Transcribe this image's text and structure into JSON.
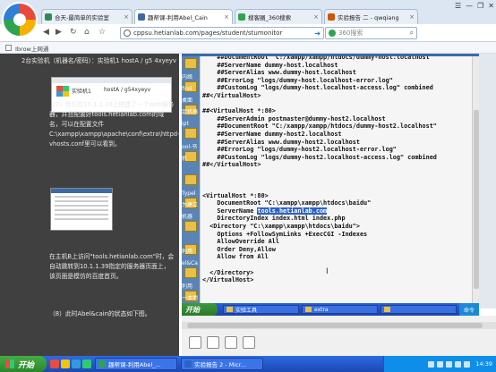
{
  "browser": {
    "tabs": [
      {
        "label": "合天-最简单的实验室",
        "icon_color": "#2e8b57",
        "active": false
      },
      {
        "label": "趣帮课-利用Abel_Cain",
        "icon_color": "#3b6aa5",
        "active": true
      },
      {
        "label": "搜客圈_360搜索",
        "icon_color": "#2ea44f",
        "active": false
      },
      {
        "label": "实验报告 二 - qwqiang",
        "icon_color": "#d35400",
        "active": false
      }
    ],
    "window_controls": [
      "☰",
      "—",
      "❐",
      "✕"
    ],
    "url": "cppsu.hetianlab.com/pages/student/stumonitor",
    "search_placeholder": "360搜索",
    "favorites": [
      {
        "label": "Ibrow上网通"
      }
    ]
  },
  "article": {
    "top_info": "2台实验机（机器名/密码）：实验机1 hostA / g5 4xyeyv",
    "thumb1": {
      "label": "实验机1",
      "path": "hostA / g54xyeyv"
    },
    "paragraphs": [
      "（7）我们在10.1.1.39上搭建了一个web服务器，并且配置好tools.hetianlab.com的域名，可以在配置文件C:\\xampp\\xampp\\apache\\conf\\extra\\httpd-vhosts.conf里可以看到。",
      "在主机B上访问\"tools.hetianlab.com\"时，会自动跳转到10.1.1.39指定的服务器页面上，该页面是模仿的百度首页。",
      "（8）此时Abel&cain的状态如下图。"
    ]
  },
  "editor": {
    "lines": [
      "    ##DocumentRoot \"C:/xampp/xampp/htdocs/dummy-host.localhost\"",
      "    ##ServerName dummy-host.localhost",
      "    ##ServerAlias www.dummy-host.localhost",
      "    ##ErrorLog \"logs/dummy-host.localhost-error.log\"",
      "    ##CustomLog \"logs/dummy-host.localhost-access.log\" combined",
      "##</VirtualHost>",
      "",
      "##<VirtualHost *:80>",
      "    ##ServerAdmin postmaster@dummy-host2.localhost",
      "    ##DocumentRoot \"C:/xampp/xampp/htdocs/dummy-host2.localhost\"",
      "    ##ServerName dummy-host2.localhost",
      "    ##ServerAlias www.dummy-host2.localhost",
      "    ##ErrorLog \"logs/dummy-host2.localhost-error.log\"",
      "    ##CustomLog \"logs/dummy-host2.localhost-access.log\" combined",
      "##</VirtualHost>",
      "",
      "",
      "",
      "<VirtualHost *:80>",
      "    DocumentRoot \"C:\\xampp\\xampp\\htdocs\\baidu\"",
      "    ServerName ",
      "    DirectoryIndex index.html index.php",
      "  <Directory \"C:\\xampp\\xampp\\htdocs\\baidu\">",
      "    Options +FollowSymLinks +ExecCGI -Indexes",
      "    AllowOverride All",
      "    Order Deny,Allow",
      "    Allow from All",
      "",
      "  </Directory>",
      "</VirtualHost>"
    ],
    "selected_text": "tools.hetianlab.com",
    "selected_line": 20
  },
  "desktop_icons": [
    "",
    "内络",
    "firel",
    "桌面",
    "定机器",
    "ipt",
    "",
    "ool-书",
    "机",
    "",
    "",
    "Typel",
    "为建立",
    "机器",
    "",
    "",
    "利用",
    "el&Ca",
    "",
    "利用",
    "一本地"
  ],
  "vm_taskbar": {
    "start_label": "开始",
    "items": [
      {
        "label": "实验工具"
      },
      {
        "label": "extra"
      },
      {
        "label": ""
      }
    ],
    "tray_label": "命令"
  },
  "host_taskbar": {
    "start_label": "开始",
    "quick_colors": [
      "#e74c3c",
      "#f1c40f",
      "#3498db",
      "#2ecc71"
    ],
    "items": [
      {
        "label": "趣帮课-利用Abel_...",
        "icon_color": "#2ea44f"
      },
      {
        "label": "实验报告 2 - Micr...",
        "icon_color": "#2b63c5"
      }
    ],
    "clock": "14:39"
  }
}
